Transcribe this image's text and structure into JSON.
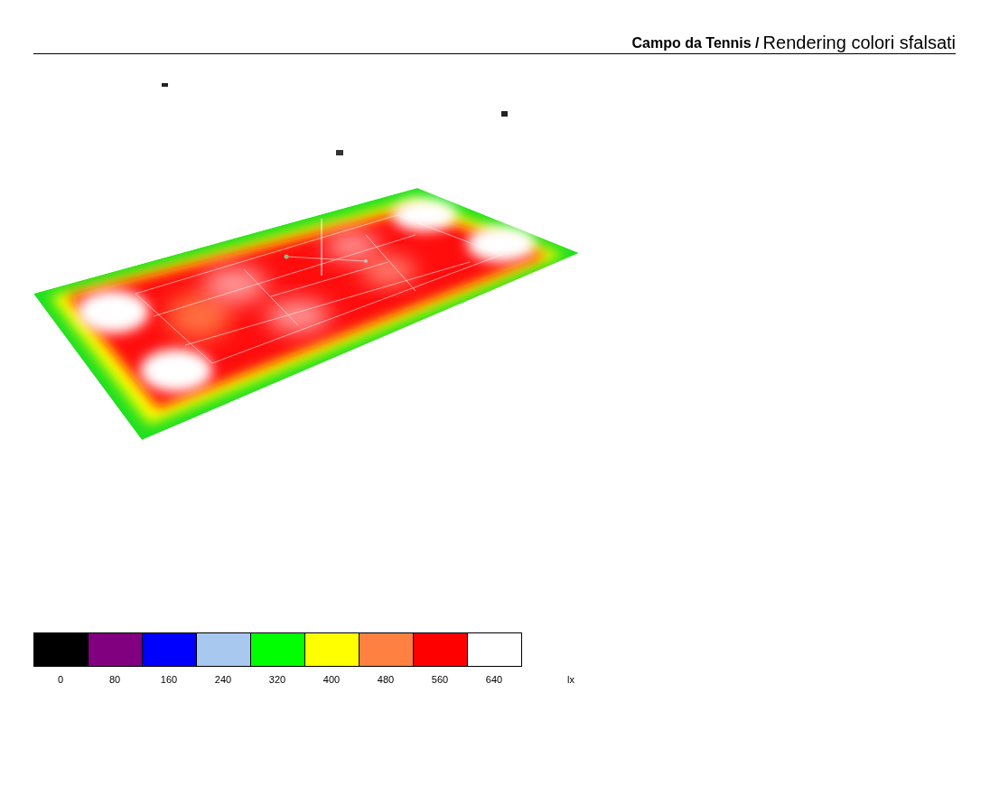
{
  "header": {
    "project": "Campo da Tennis /",
    "title": "Rendering colori sfalsati"
  },
  "legend": {
    "unit": "lx",
    "items": [
      {
        "value": "0",
        "color": "#000000"
      },
      {
        "value": "80",
        "color": "#800080"
      },
      {
        "value": "160",
        "color": "#0000ff"
      },
      {
        "value": "240",
        "color": "#a8c8f0"
      },
      {
        "value": "320",
        "color": "#00ff00"
      },
      {
        "value": "400",
        "color": "#ffff00"
      },
      {
        "value": "480",
        "color": "#ff8040"
      },
      {
        "value": "560",
        "color": "#ff0000"
      },
      {
        "value": "640",
        "color": "#ffffff"
      }
    ]
  }
}
